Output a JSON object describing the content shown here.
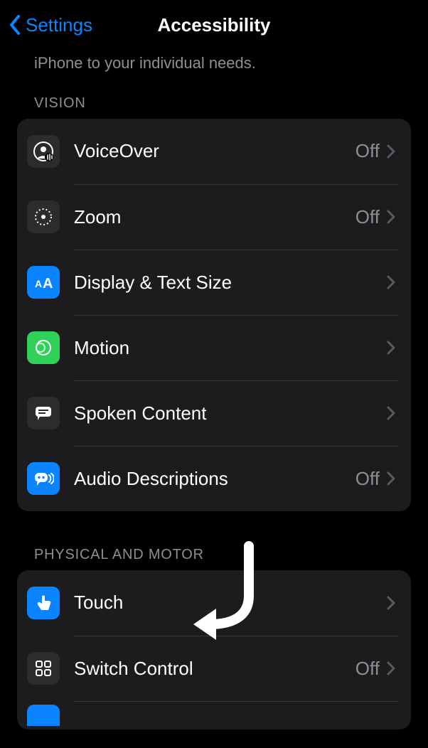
{
  "nav": {
    "back_label": "Settings",
    "title": "Accessibility"
  },
  "intro": "iPhone to your individual needs.",
  "sections": {
    "vision": {
      "header": "VISION",
      "items": {
        "voiceover": {
          "label": "VoiceOver",
          "value": "Off"
        },
        "zoom": {
          "label": "Zoom",
          "value": "Off"
        },
        "display": {
          "label": "Display & Text Size",
          "value": ""
        },
        "motion": {
          "label": "Motion",
          "value": ""
        },
        "spoken": {
          "label": "Spoken Content",
          "value": ""
        },
        "audiodesc": {
          "label": "Audio Descriptions",
          "value": "Off"
        }
      }
    },
    "physical": {
      "header": "PHYSICAL AND MOTOR",
      "items": {
        "touch": {
          "label": "Touch",
          "value": ""
        },
        "switchctrl": {
          "label": "Switch Control",
          "value": "Off"
        }
      }
    }
  }
}
